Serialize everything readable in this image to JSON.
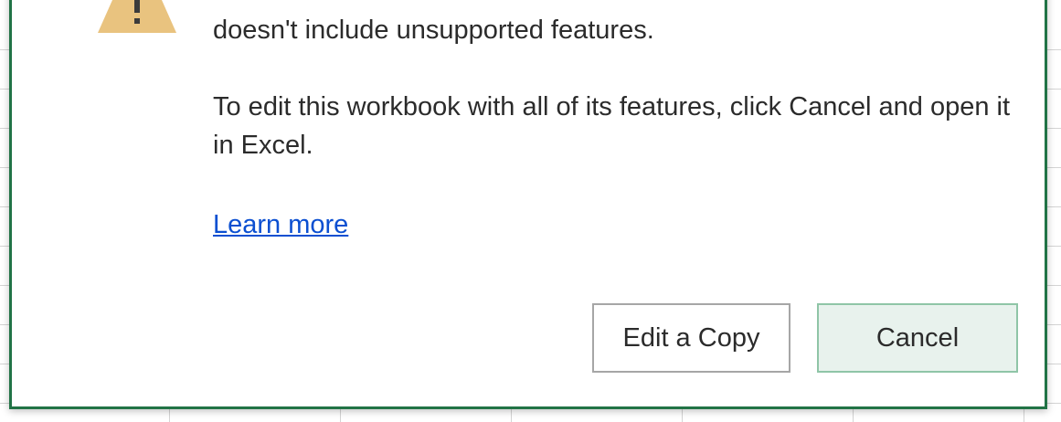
{
  "dialog": {
    "message_line_1": "doesn't include unsupported features.",
    "message_line_2": "To edit this workbook with all of its features, click Cancel and open it in Excel.",
    "learn_more_label": "Learn more",
    "edit_copy_label": "Edit a Copy",
    "cancel_label": "Cancel"
  },
  "icons": {
    "warning": "warning-icon"
  },
  "colors": {
    "dialog_border": "#217346",
    "warning_fill": "#e9c37f",
    "link": "#0b4fd1",
    "primary_button_bg": "#e8f2ed",
    "primary_button_border": "#8fc5a7",
    "grid_line": "#d4d4d4"
  }
}
